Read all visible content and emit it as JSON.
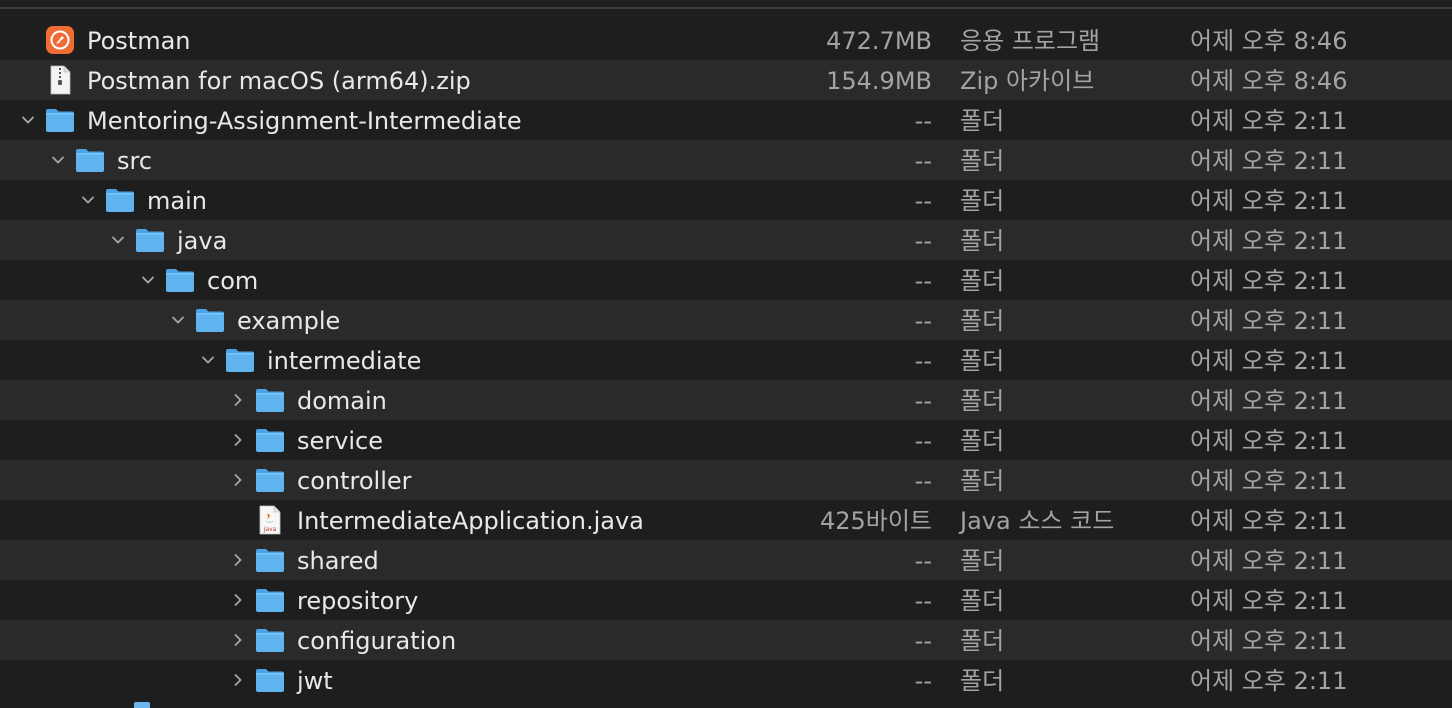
{
  "rows": [
    {
      "name": "Postman",
      "size": "472.7MB",
      "kind": "응용 프로그램",
      "date": "어제 오후 8:46",
      "icon": "postman-app-icon",
      "chevron": "none",
      "level": 0
    },
    {
      "name": "Postman for macOS (arm64).zip",
      "size": "154.9MB",
      "kind": "Zip 아카이브",
      "date": "어제 오후 8:46",
      "icon": "zip-file-icon",
      "chevron": "none",
      "level": 0
    },
    {
      "name": "Mentoring-Assignment-Intermediate",
      "size": "--",
      "kind": "폴더",
      "date": "어제 오후 2:11",
      "icon": "folder-icon",
      "chevron": "down",
      "level": 0
    },
    {
      "name": "src",
      "size": "--",
      "kind": "폴더",
      "date": "어제 오후 2:11",
      "icon": "folder-icon",
      "chevron": "down",
      "level": 1
    },
    {
      "name": "main",
      "size": "--",
      "kind": "폴더",
      "date": "어제 오후 2:11",
      "icon": "folder-icon",
      "chevron": "down",
      "level": 2
    },
    {
      "name": "java",
      "size": "--",
      "kind": "폴더",
      "date": "어제 오후 2:11",
      "icon": "folder-icon",
      "chevron": "down",
      "level": 3
    },
    {
      "name": "com",
      "size": "--",
      "kind": "폴더",
      "date": "어제 오후 2:11",
      "icon": "folder-icon",
      "chevron": "down",
      "level": 4
    },
    {
      "name": "example",
      "size": "--",
      "kind": "폴더",
      "date": "어제 오후 2:11",
      "icon": "folder-icon",
      "chevron": "down",
      "level": 5
    },
    {
      "name": "intermediate",
      "size": "--",
      "kind": "폴더",
      "date": "어제 오후 2:11",
      "icon": "folder-icon",
      "chevron": "down",
      "level": 6
    },
    {
      "name": "domain",
      "size": "--",
      "kind": "폴더",
      "date": "어제 오후 2:11",
      "icon": "folder-icon",
      "chevron": "right",
      "level": 7
    },
    {
      "name": "service",
      "size": "--",
      "kind": "폴더",
      "date": "어제 오후 2:11",
      "icon": "folder-icon",
      "chevron": "right",
      "level": 7
    },
    {
      "name": "controller",
      "size": "--",
      "kind": "폴더",
      "date": "어제 오후 2:11",
      "icon": "folder-icon",
      "chevron": "right",
      "level": 7
    },
    {
      "name": "IntermediateApplication.java",
      "size": "425바이트",
      "kind": "Java 소스 코드",
      "date": "어제 오후 2:11",
      "icon": "java-file-icon",
      "chevron": "none",
      "level": 7
    },
    {
      "name": "shared",
      "size": "--",
      "kind": "폴더",
      "date": "어제 오후 2:11",
      "icon": "folder-icon",
      "chevron": "right",
      "level": 7
    },
    {
      "name": "repository",
      "size": "--",
      "kind": "폴더",
      "date": "어제 오후 2:11",
      "icon": "folder-icon",
      "chevron": "right",
      "level": 7
    },
    {
      "name": "configuration",
      "size": "--",
      "kind": "폴더",
      "date": "어제 오후 2:11",
      "icon": "folder-icon",
      "chevron": "right",
      "level": 7
    },
    {
      "name": "jwt",
      "size": "--",
      "kind": "폴더",
      "date": "어제 오후 2:11",
      "icon": "folder-icon",
      "chevron": "right",
      "level": 7
    }
  ],
  "colors": {
    "folder": "#5fb3ef",
    "folder_tab": "#4aa3e6",
    "postman": "#ef6c35",
    "row_alt": "#2a2a2a",
    "row_base": "#1e1e1e"
  }
}
